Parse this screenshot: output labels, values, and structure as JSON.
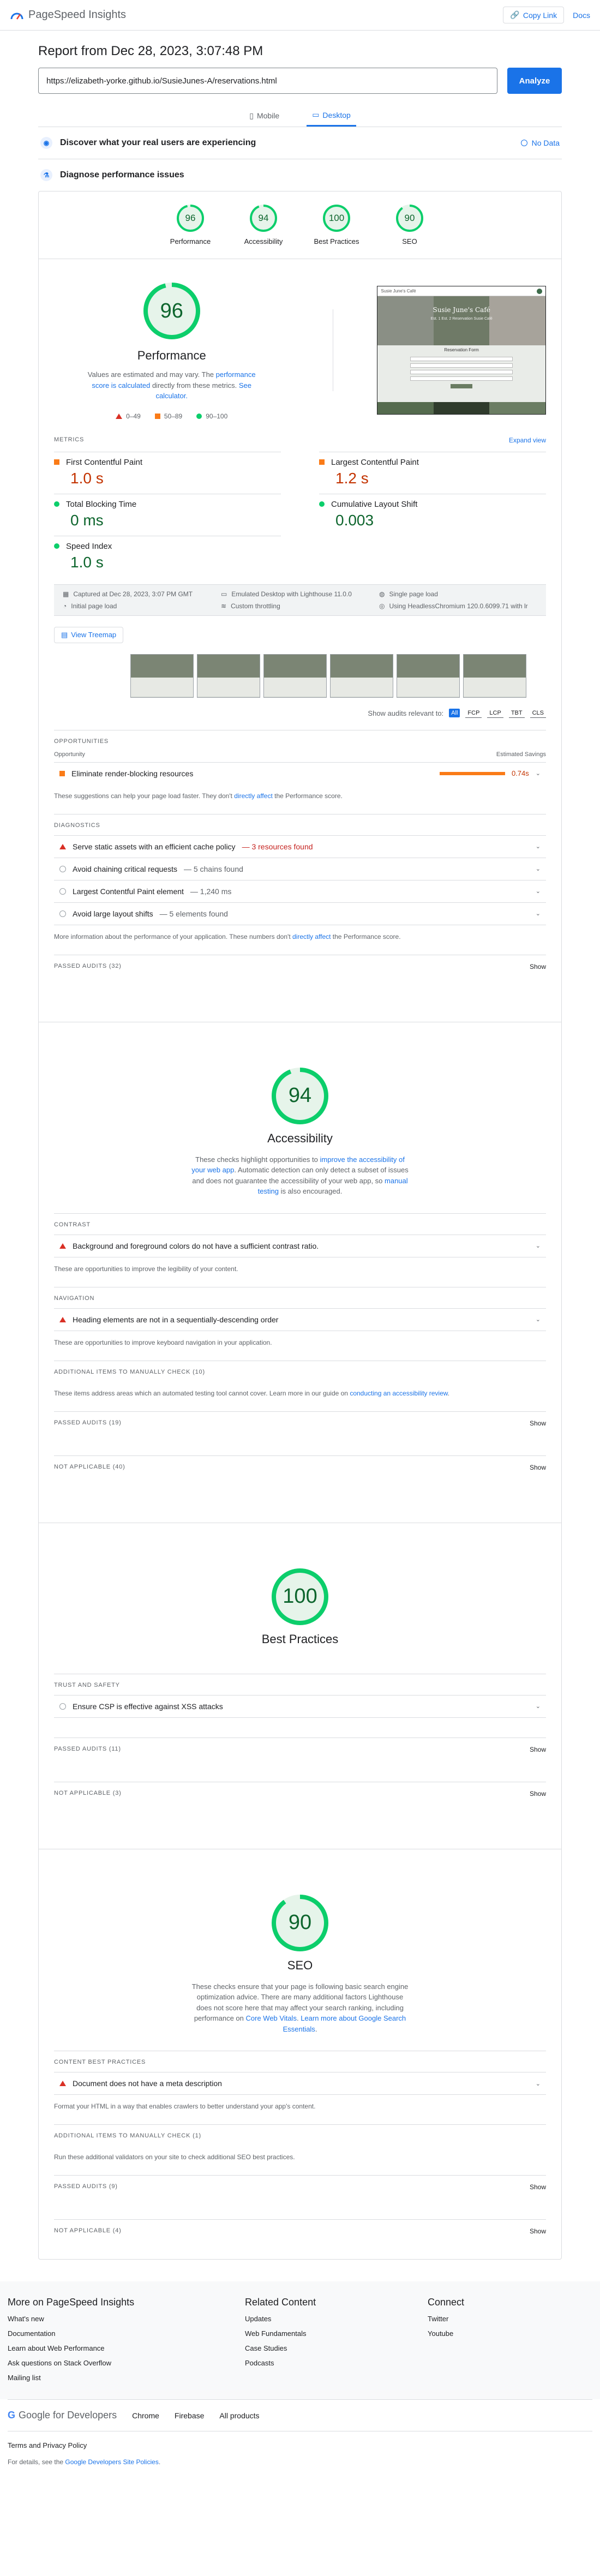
{
  "app": {
    "title": "PageSpeed Insights",
    "copy_link": "Copy Link",
    "docs": "Docs"
  },
  "report": {
    "title": "Report from Dec 28, 2023, 3:07:48 PM",
    "url": "https://elizabeth-yorke.github.io/SusieJunes-A/reservations.html",
    "analyze": "Analyze"
  },
  "tabs": [
    {
      "label": "Mobile",
      "icon": "phone-icon"
    },
    {
      "label": "Desktop",
      "icon": "desktop-icon",
      "active": true
    }
  ],
  "discover": {
    "title": "Discover what your real users are experiencing",
    "status": "No Data"
  },
  "diagnose": {
    "title": "Diagnose performance issues"
  },
  "scores": [
    {
      "label": "Performance",
      "value": "96",
      "score": 0.96
    },
    {
      "label": "Accessibility",
      "value": "94",
      "score": 0.94
    },
    {
      "label": "Best Practices",
      "value": "100",
      "score": 1.0
    },
    {
      "label": "SEO",
      "value": "90",
      "score": 0.9
    }
  ],
  "performance": {
    "score": "96",
    "title": "Performance",
    "desc_pre": "Values are estimated and may vary. The ",
    "desc_link": "performance score is calculated",
    "desc_post": " directly from these metrics. ",
    "desc_link2": "See calculator.",
    "legend": [
      "0–49",
      "50–89",
      "90–100"
    ],
    "screenshot": {
      "header_url": "Susie June's Café",
      "hero_title": "Susie June's Café",
      "hero_sub": "Est. 1 Est. 2 Reservation Susie Café",
      "form_title": "Reservation Form"
    }
  },
  "metrics": {
    "label": "METRICS",
    "expand": "Expand view",
    "items": [
      {
        "name": "First Contentful Paint",
        "value": "1.0 s",
        "status": "orange"
      },
      {
        "name": "Largest Contentful Paint",
        "value": "1.2 s",
        "status": "orange"
      },
      {
        "name": "Total Blocking Time",
        "value": "0 ms",
        "status": "green"
      },
      {
        "name": "Cumulative Layout Shift",
        "value": "0.003",
        "status": "green"
      },
      {
        "name": "Speed Index",
        "value": "1.0 s",
        "status": "green"
      }
    ]
  },
  "env": [
    "Captured at Dec 28, 2023, 3:07 PM GMT",
    "Emulated Desktop with Lighthouse 11.0.0",
    "Single page load",
    "Initial page load",
    "Custom throttling",
    "Using HeadlessChromium 120.0.6099.71 with lr"
  ],
  "treemap": "View Treemap",
  "filters": {
    "label": "Show audits relevant to:",
    "chips": [
      "All",
      "FCP",
      "LCP",
      "TBT",
      "CLS"
    ]
  },
  "opportunities": {
    "label": "OPPORTUNITIES",
    "col1": "Opportunity",
    "col2": "Estimated Savings",
    "items": [
      {
        "title": "Eliminate render-blocking resources",
        "savings": "0.74s"
      }
    ],
    "note_pre": "These suggestions can help your page load faster. They don't ",
    "note_link": "directly affect",
    "note_post": " the Performance score."
  },
  "diagnostics": {
    "label": "DIAGNOSTICS",
    "items": [
      {
        "title": "Serve static assets with an efficient cache policy",
        "detail": " — 3 resources found",
        "status": "red"
      },
      {
        "title": "Avoid chaining critical requests",
        "detail": " — 5 chains found",
        "status": "info"
      },
      {
        "title": "Largest Contentful Paint element",
        "detail": " — 1,240 ms",
        "status": "info"
      },
      {
        "title": "Avoid large layout shifts",
        "detail": " — 5 elements found",
        "status": "info"
      }
    ],
    "note_pre": "More information about the performance of your application. These numbers don't ",
    "note_link": "directly affect",
    "note_post": " the Performance score."
  },
  "perf_passed": "PASSED AUDITS (32)",
  "show": "Show",
  "accessibility": {
    "score": "94",
    "title": "Accessibility",
    "desc_pre": "These checks highlight opportunities to ",
    "desc_link": "improve the accessibility of your web app",
    "desc_mid": ". Automatic detection can only detect a subset of issues and does not guarantee the accessibility of your web app, so ",
    "desc_link2": "manual testing",
    "desc_post": " is also encouraged.",
    "contrast_label": "CONTRAST",
    "contrast_item": "Background and foreground colors do not have a sufficient contrast ratio.",
    "contrast_note": "These are opportunities to improve the legibility of your content.",
    "nav_label": "NAVIGATION",
    "nav_item": "Heading elements are not in a sequentially-descending order",
    "nav_note": "These are opportunities to improve keyboard navigation in your application.",
    "manual_label": "ADDITIONAL ITEMS TO MANUALLY CHECK (10)",
    "manual_note_pre": "These items address areas which an automated testing tool cannot cover. Learn more in our guide on ",
    "manual_note_link": "conducting an accessibility review",
    "manual_note_post": ".",
    "passed": "PASSED AUDITS (19)",
    "na": "NOT APPLICABLE (40)"
  },
  "best_practices": {
    "score": "100",
    "title": "Best Practices",
    "trust_label": "TRUST AND SAFETY",
    "trust_item": "Ensure CSP is effective against XSS attacks",
    "passed": "PASSED AUDITS (11)",
    "na": "NOT APPLICABLE (3)"
  },
  "seo": {
    "score": "90",
    "title": "SEO",
    "desc_pre": "These checks ensure that your page is following basic search engine optimization advice. There are many additional factors Lighthouse does not score here that may affect your search ranking, including performance on ",
    "desc_link": "Core Web Vitals",
    "desc_mid": ". ",
    "desc_link2": "Learn more about Google Search Essentials",
    "desc_post": ".",
    "content_label": "CONTENT BEST PRACTICES",
    "content_item": "Document does not have a meta description",
    "content_note": "Format your HTML in a way that enables crawlers to better understand your app's content.",
    "manual_label": "ADDITIONAL ITEMS TO MANUALLY CHECK (1)",
    "manual_note": "Run these additional validators on your site to check additional SEO best practices.",
    "passed": "PASSED AUDITS (9)",
    "na": "NOT APPLICABLE (4)"
  },
  "footer": {
    "col1_title": "More on PageSpeed Insights",
    "col1": [
      "What's new",
      "Documentation",
      "Learn about Web Performance",
      "Ask questions on Stack Overflow",
      "Mailing list"
    ],
    "col2_title": "Related Content",
    "col2": [
      "Updates",
      "Web Fundamentals",
      "Case Studies",
      "Podcasts"
    ],
    "col3_title": "Connect",
    "col3": [
      "Twitter",
      "Youtube"
    ],
    "brand": "Google for Developers",
    "products": [
      "Chrome",
      "Firebase",
      "All products"
    ],
    "terms": "Terms and Privacy Policy",
    "details_pre": "For details, see the ",
    "details_link": "Google Developers Site Policies",
    "details_post": "."
  },
  "colors": {
    "green": "#0cce6b",
    "orange": "#fa7b17",
    "red": "#d93025",
    "blue": "#1a73e8"
  }
}
